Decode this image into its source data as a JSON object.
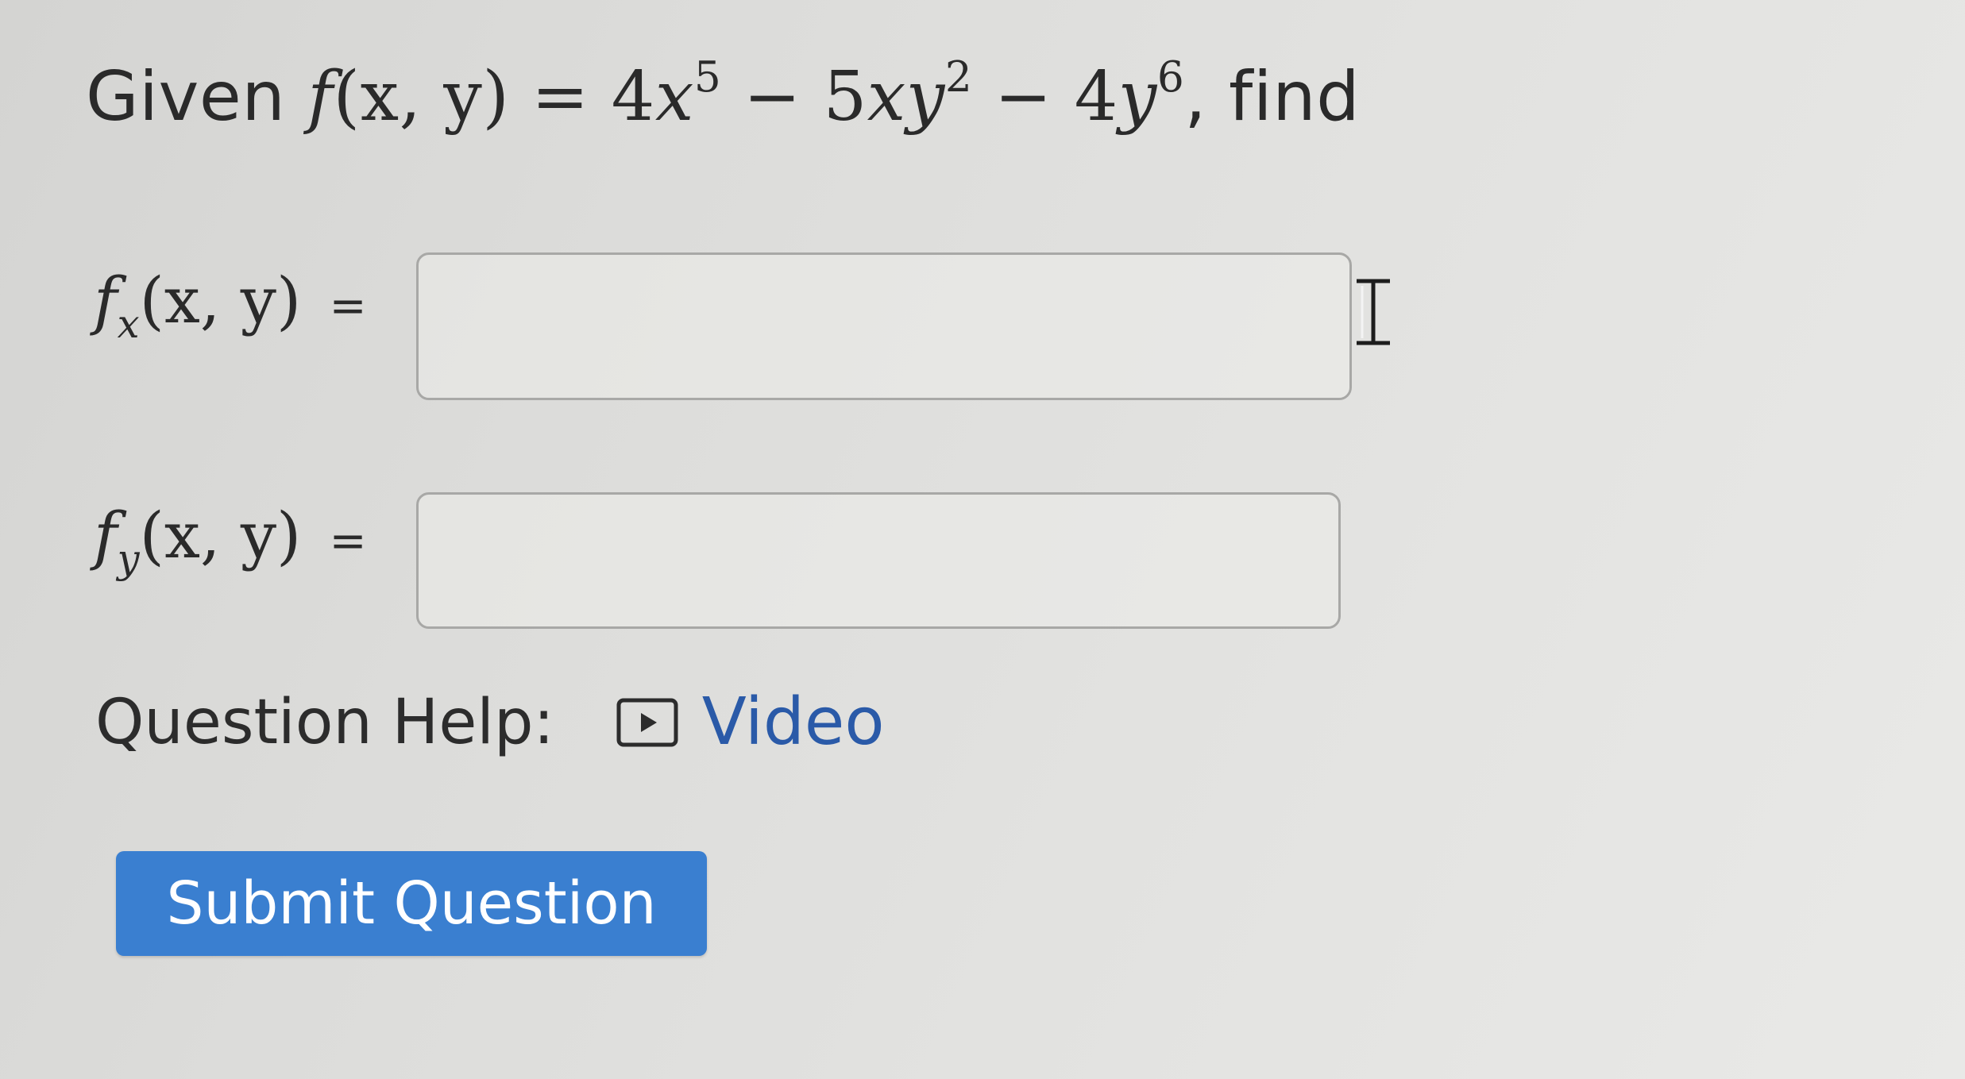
{
  "question": {
    "given_label": "Given",
    "function_name": "f",
    "function_args": "(x, y)",
    "equals": "=",
    "term1_coef": "4",
    "term1_var": "x",
    "term1_exp": "5",
    "minus1": "−",
    "term2_coef": "5",
    "term2_var": "xy",
    "term2_exp": "2",
    "minus2": "−",
    "term3_coef": "4",
    "term3_var": "y",
    "term3_exp": "6",
    "find_label": ", find"
  },
  "fx": {
    "func": "f",
    "subscript": "x",
    "args": "(x, y)",
    "equals": "=",
    "value": ""
  },
  "fy": {
    "func": "f",
    "subscript": "y",
    "args": "(x, y)",
    "equals": "=",
    "value": ""
  },
  "help": {
    "label": "Question Help:",
    "video_label": "Video",
    "video_icon": "play-icon"
  },
  "submit": {
    "label": "Submit Question"
  },
  "colors": {
    "submit_bg": "#3a7fd0",
    "link": "#2a5aa8",
    "text": "#2a2a2a"
  }
}
